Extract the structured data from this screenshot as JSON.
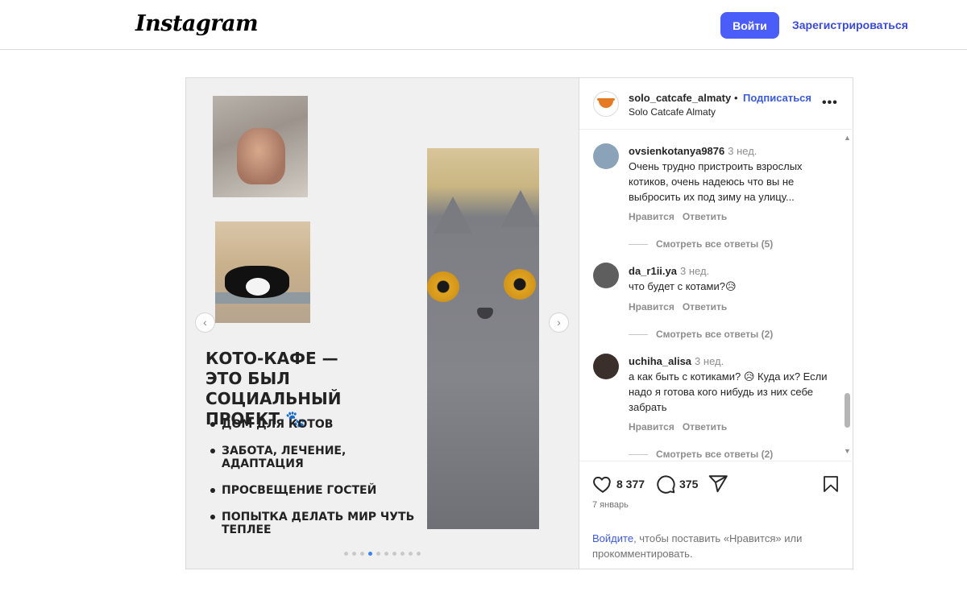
{
  "header": {
    "logo": "Instagram",
    "login_button": "Войти",
    "signup_link": "Зарегистрироваться"
  },
  "post": {
    "slide": {
      "title_lines": [
        "КОТО-КАФЕ —",
        "ЭТО БЫЛ СОЦИАЛЬНЫЙ",
        "ПРОЕКТ 🐾"
      ],
      "bullets": [
        "ДОМ ДЛЯ КОТОВ",
        "ЗАБОТА, ЛЕЧЕНИЕ, АДАПТАЦИЯ",
        "ПРОСВЕЩЕНИЕ ГОСТЕЙ",
        "ПОПЫТКА ДЕЛАТЬ МИР ЧУТЬ ТЕПЛЕЕ"
      ],
      "prev_icon": "chevron-left-icon",
      "next_icon": "chevron-right-icon",
      "prev_glyph": "‹",
      "next_glyph": "›",
      "carousel_dots": 10,
      "active_dot": 3
    },
    "author": {
      "username": "solo_catcafe_almaty",
      "separator": "•",
      "follow": "Подписаться",
      "display_name": "Solo Catcafe Almaty",
      "more_glyph": "•••"
    },
    "comments": [
      {
        "username": "ovsienkotanya9876",
        "time": "3 нед.",
        "text": "Очень трудно пристроить взрослых котиков, очень надеюсь что вы не выбросить их под зиму на улицу...",
        "like": "Нравится",
        "reply": "Ответить",
        "view_replies": "Смотреть все ответы (5)",
        "avatar_color": "#8aa3b8"
      },
      {
        "username": "da_r1ii.ya",
        "time": "3 нед.",
        "text": "что будет с котами?😥",
        "like": "Нравится",
        "reply": "Ответить",
        "view_replies": "Смотреть все ответы (2)",
        "avatar_color": "#5e5e5e"
      },
      {
        "username": "uchiha_alisa",
        "time": "3 нед.",
        "text": "а как быть с котиками? 😥 Куда их? Если надо я готова кого нибудь из них себе забрать",
        "like": "Нравится",
        "reply": "Ответить",
        "view_replies": "Смотреть все ответы (2)",
        "avatar_color": "#3a2f2a"
      }
    ],
    "scroll": {
      "up_glyph": "▲",
      "down_glyph": "▼"
    },
    "likes": "8 377",
    "comments_count": "375",
    "date": "7 январь",
    "login_prompt_link": "Войдите",
    "login_prompt_text": ", чтобы поставить «Нравится» или прокомментировать.",
    "icons": {
      "like": "heart-icon",
      "comment": "comment-bubble-icon",
      "share": "paper-plane-icon",
      "save": "bookmark-icon"
    },
    "colors": {
      "accent": "#4a5df9",
      "link": "#3b5bd6",
      "muted": "#8e8e8e"
    }
  }
}
